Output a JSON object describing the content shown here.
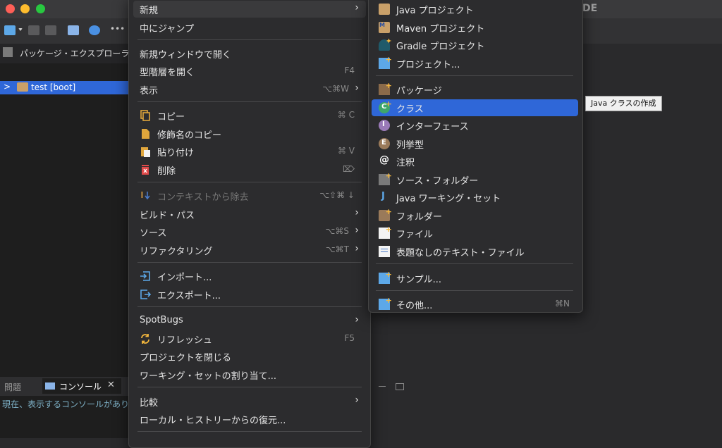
{
  "ide": {
    "title_fragment": "DE",
    "package_explorer_tab": "パッケージ・エクスプローラ",
    "tree_item": "test [boot]",
    "problems_tab": "問題",
    "console_tab": "コンソール",
    "console_message": "現在、表示するコンソールがありま"
  },
  "context_menu": {
    "new": "新規",
    "goto_into": "中にジャンプ",
    "open_new_window": "新規ウィンドウで開く",
    "open_type_hierarchy": "型階層を開く",
    "open_type_hierarchy_sc": "F4",
    "show": "表示",
    "show_sc": "⌥⌘W",
    "copy": "コピー",
    "copy_sc": "⌘ C",
    "copy_qualified": "修飾名のコピー",
    "paste": "貼り付け",
    "paste_sc": "⌘ V",
    "delete": "削除",
    "delete_sc": "⌦",
    "remove_context": "コンテキストから除去",
    "remove_context_sc": "⌥⇧⌘ ↓",
    "build_path": "ビルド・パス",
    "source": "ソース",
    "source_sc": "⌥⌘S",
    "refactor": "リファクタリング",
    "refactor_sc": "⌥⌘T",
    "import": "インポート...",
    "export": "エクスポート...",
    "spotbugs": "SpotBugs",
    "refresh": "リフレッシュ",
    "refresh_sc": "F5",
    "close_project": "プロジェクトを閉じる",
    "assign_working_set": "ワーキング・セットの割り当て...",
    "compare": "比較",
    "restore_local_history": "ローカル・ヒストリーからの復元..."
  },
  "submenu": {
    "java_project": "Java プロジェクト",
    "maven_project": "Maven プロジェクト",
    "gradle_project": "Gradle プロジェクト",
    "project": "プロジェクト...",
    "package": "パッケージ",
    "class": "クラス",
    "interface": "インターフェース",
    "enum": "列挙型",
    "annotation": "注釈",
    "source_folder": "ソース・フォルダー",
    "java_working_set": "Java ワーキング・セット",
    "folder": "フォルダー",
    "file": "ファイル",
    "untitled_text_file": "表題なしのテキスト・ファイル",
    "example": "サンプル...",
    "other": "その他...",
    "other_sc": "⌘N"
  },
  "tooltip": "Java クラスの作成",
  "colors": {
    "highlight": "#2f67d8",
    "menu_bg": "#2c2c2e",
    "accent_plus": "#f5b83d"
  }
}
